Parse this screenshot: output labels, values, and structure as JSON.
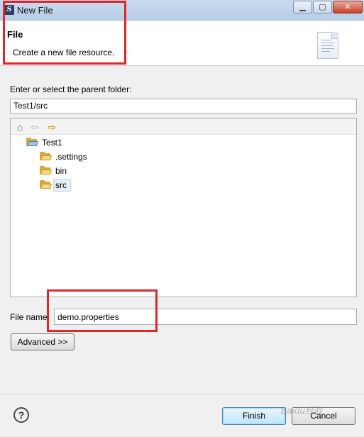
{
  "window": {
    "title": "New File",
    "minimize_glyph": "▁",
    "maximize_glyph": "▢",
    "close_glyph": "✕"
  },
  "header": {
    "title": "File",
    "description": "Create a new file resource."
  },
  "parent_folder": {
    "label": "Enter or select the parent folder:",
    "value": "Test1/src"
  },
  "tree_toolbar": {
    "home_icon": "⌂",
    "back_icon": "⇦",
    "forward_icon": "⇨"
  },
  "tree": {
    "items": [
      {
        "label": "Test1",
        "icon": "project-folder-icon"
      },
      {
        "label": ".settings",
        "icon": "folder-icon"
      },
      {
        "label": "bin",
        "icon": "folder-icon"
      },
      {
        "label": "src",
        "icon": "folder-icon",
        "selected": true
      }
    ]
  },
  "file_name": {
    "label": "File name:",
    "value": "demo.properties"
  },
  "advanced_button": "Advanced >>",
  "footer": {
    "help_glyph": "?",
    "finish": "Finish",
    "cancel": "Cancel",
    "watermark": "Baidu经验"
  },
  "colors": {
    "highlight_box": "#e0252b",
    "default_button": "#bee6fd"
  }
}
